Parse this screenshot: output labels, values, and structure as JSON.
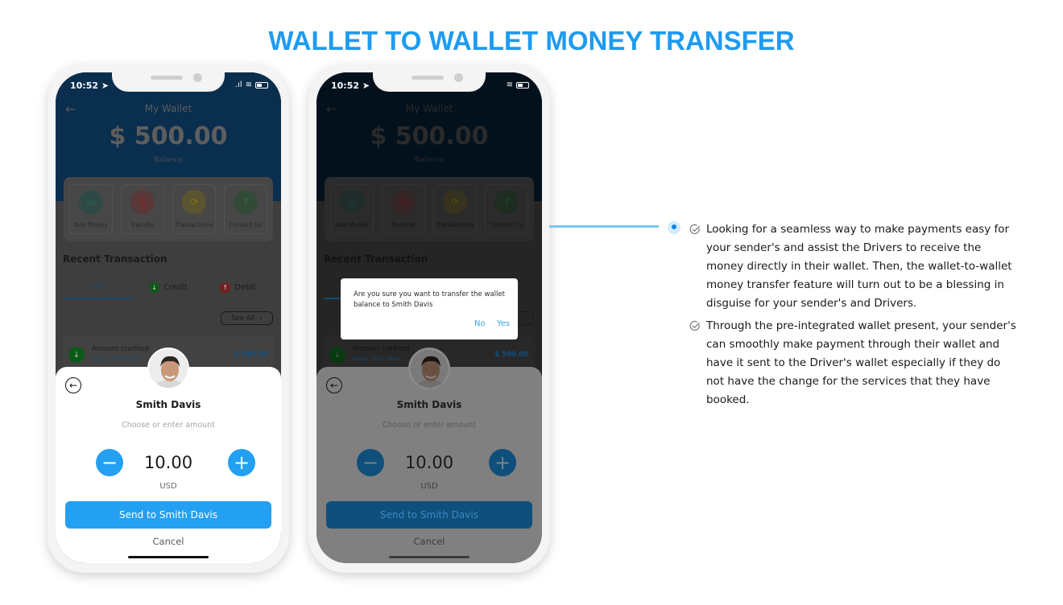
{
  "page": {
    "title": "WALLET TO WALLET MONEY TRANSFER",
    "accent_color": "#1e9bf0"
  },
  "phone": {
    "status_time": "10:52",
    "wallet_title": "My Wallet",
    "balance": "$ 500.00",
    "balance_label": "Balance",
    "actions": [
      {
        "label": "Add Money",
        "icon": "folder-icon"
      },
      {
        "label": "Transfer",
        "icon": "transfer-icon"
      },
      {
        "label": "Transactions",
        "icon": "refresh-icon"
      },
      {
        "label": "Contact Us",
        "icon": "help-icon"
      }
    ],
    "recent_title": "Recent Transaction",
    "tabs": [
      {
        "label": "All",
        "active": true
      },
      {
        "label": "Credit",
        "active": false
      },
      {
        "label": "Debit",
        "active": false
      }
    ],
    "see_all": "See All",
    "transaction": {
      "title": "Amount credited",
      "date": "24 Jul, 2023 (Mon)",
      "amount": "$ 500.00"
    },
    "sheet": {
      "recipient": "Smith Davis",
      "hint": "Choose or enter amount",
      "amount": "10.00",
      "currency": "USD",
      "send_label": "Send to Smith Davis",
      "cancel_label": "Cancel"
    }
  },
  "dialog": {
    "message": "Are you sure you want to transfer the wallet balance to Smith Davis",
    "no_label": "No",
    "yes_label": "Yes"
  },
  "features": [
    "Looking for a seamless way to make payments easy for your sender's and assist the Drivers to receive the money directly in their wallet. Then, the wallet-to-wallet money transfer feature will turn out to be a blessing in disguise for your sender's and Drivers.",
    "Through the pre-integrated wallet present, your sender's can smoothly make payment through their wallet and have it sent to the Driver's wallet especially if they do not have the change for the services that they have booked."
  ]
}
